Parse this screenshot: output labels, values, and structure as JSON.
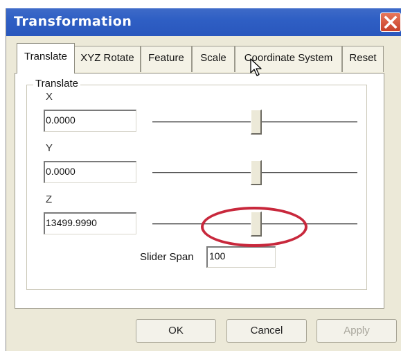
{
  "window": {
    "title": "Transformation",
    "close_icon": "close-icon"
  },
  "tabs": [
    {
      "label": "Translate",
      "active": true
    },
    {
      "label": "XYZ Rotate",
      "active": false
    },
    {
      "label": "Feature",
      "active": false
    },
    {
      "label": "Scale",
      "active": false
    },
    {
      "label": "Coordinate System",
      "active": false
    },
    {
      "label": "Reset",
      "active": false
    }
  ],
  "translate": {
    "group_label": "Translate",
    "x": {
      "label": "X",
      "value": "0.0000",
      "slider_position": 0.5
    },
    "y": {
      "label": "Y",
      "value": "0.0000",
      "slider_position": 0.5
    },
    "z": {
      "label": "Z",
      "value": "13499.9990",
      "slider_position": 0.5
    },
    "slider_span": {
      "label": "Slider Span",
      "value": "100"
    }
  },
  "buttons": {
    "ok": "OK",
    "cancel": "Cancel",
    "apply": "Apply",
    "apply_enabled": false
  },
  "annotation": {
    "color": "#c8283c",
    "shape": "ellipse around Z slider"
  },
  "colors": {
    "titlebar": "#2f5fc4",
    "dialog_bg": "#ece9d8",
    "close_button": "#d25a3e"
  }
}
